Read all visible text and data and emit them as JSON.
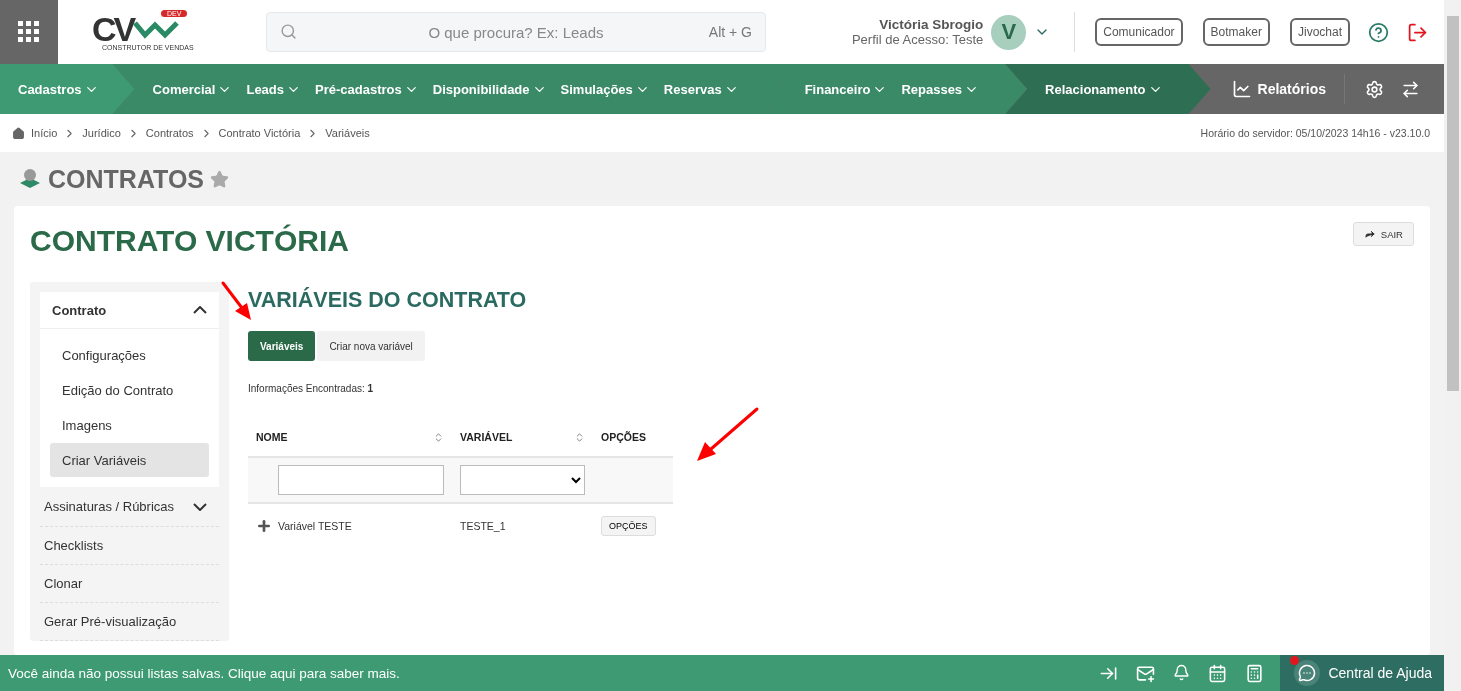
{
  "logo": {
    "letters": "CV",
    "badge": "DEV",
    "tagline": "CONSTRUTOR DE VENDAS"
  },
  "search": {
    "placeholder": "O que procura? Ex: Leads",
    "shortcut": "Alt + G"
  },
  "user": {
    "name": "Victória Sbrogio",
    "profile": "Perfil de Acesso: Teste",
    "initial": "V"
  },
  "header_buttons": [
    "Comunicador",
    "Botmaker",
    "Jivochat"
  ],
  "nav": {
    "groups": [
      {
        "items": [
          "Cadastros"
        ]
      },
      {
        "items": [
          "Comercial",
          "Leads",
          "Pré-cadastros",
          "Disponibilidade",
          "Simulações",
          "Reservas"
        ]
      },
      {
        "items": [
          "Financeiro",
          "Repasses"
        ]
      },
      {
        "items": [
          "Relacionamento"
        ]
      }
    ],
    "reports": "Relatórios"
  },
  "breadcrumb": [
    "Início",
    "Jurídico",
    "Contratos",
    "Contrato Victória",
    "Variáveis"
  ],
  "server_time": "Horário do servidor: 05/10/2023 14h16 - v23.10.0",
  "page_title": "CONTRATOS",
  "favorite": false,
  "card_title": "CONTRATO VICTÓRIA",
  "exit_button": "SAIR",
  "sidebar": [
    {
      "kind": "section",
      "label": "Contrato",
      "expanded": true,
      "children": [
        {
          "label": "Configurações",
          "selected": false
        },
        {
          "label": "Edição do Contrato",
          "selected": false
        },
        {
          "label": "Imagens",
          "selected": false
        },
        {
          "label": "Criar Variáveis",
          "selected": true
        }
      ]
    },
    {
      "kind": "section",
      "label": "Assinaturas / Rúbricas",
      "expanded": false
    },
    {
      "kind": "link",
      "label": "Checklists"
    },
    {
      "kind": "link",
      "label": "Clonar"
    },
    {
      "kind": "link",
      "label": "Gerar Pré-visualização"
    }
  ],
  "section_title": "VARIÁVEIS DO CONTRATO",
  "tabs": [
    {
      "label": "Variáveis",
      "selected": true
    },
    {
      "label": "Criar nova variável",
      "selected": false
    }
  ],
  "count": {
    "label": "Informações Encontradas:",
    "value": "1"
  },
  "table": {
    "columns": [
      {
        "label": "NOME",
        "sortable": true
      },
      {
        "label": "VARIÁVEL",
        "sortable": true
      },
      {
        "label": "OPÇÕES",
        "sortable": false
      }
    ],
    "rows": [
      {
        "name": "Variável TESTE",
        "variable": "TESTE_1",
        "action": "OPÇÕES"
      }
    ]
  },
  "footer": {
    "message": "Você ainda não possui listas salvas. Clique aqui para saber mais.",
    "help": "Central de Ajuda",
    "help_unread": true
  }
}
